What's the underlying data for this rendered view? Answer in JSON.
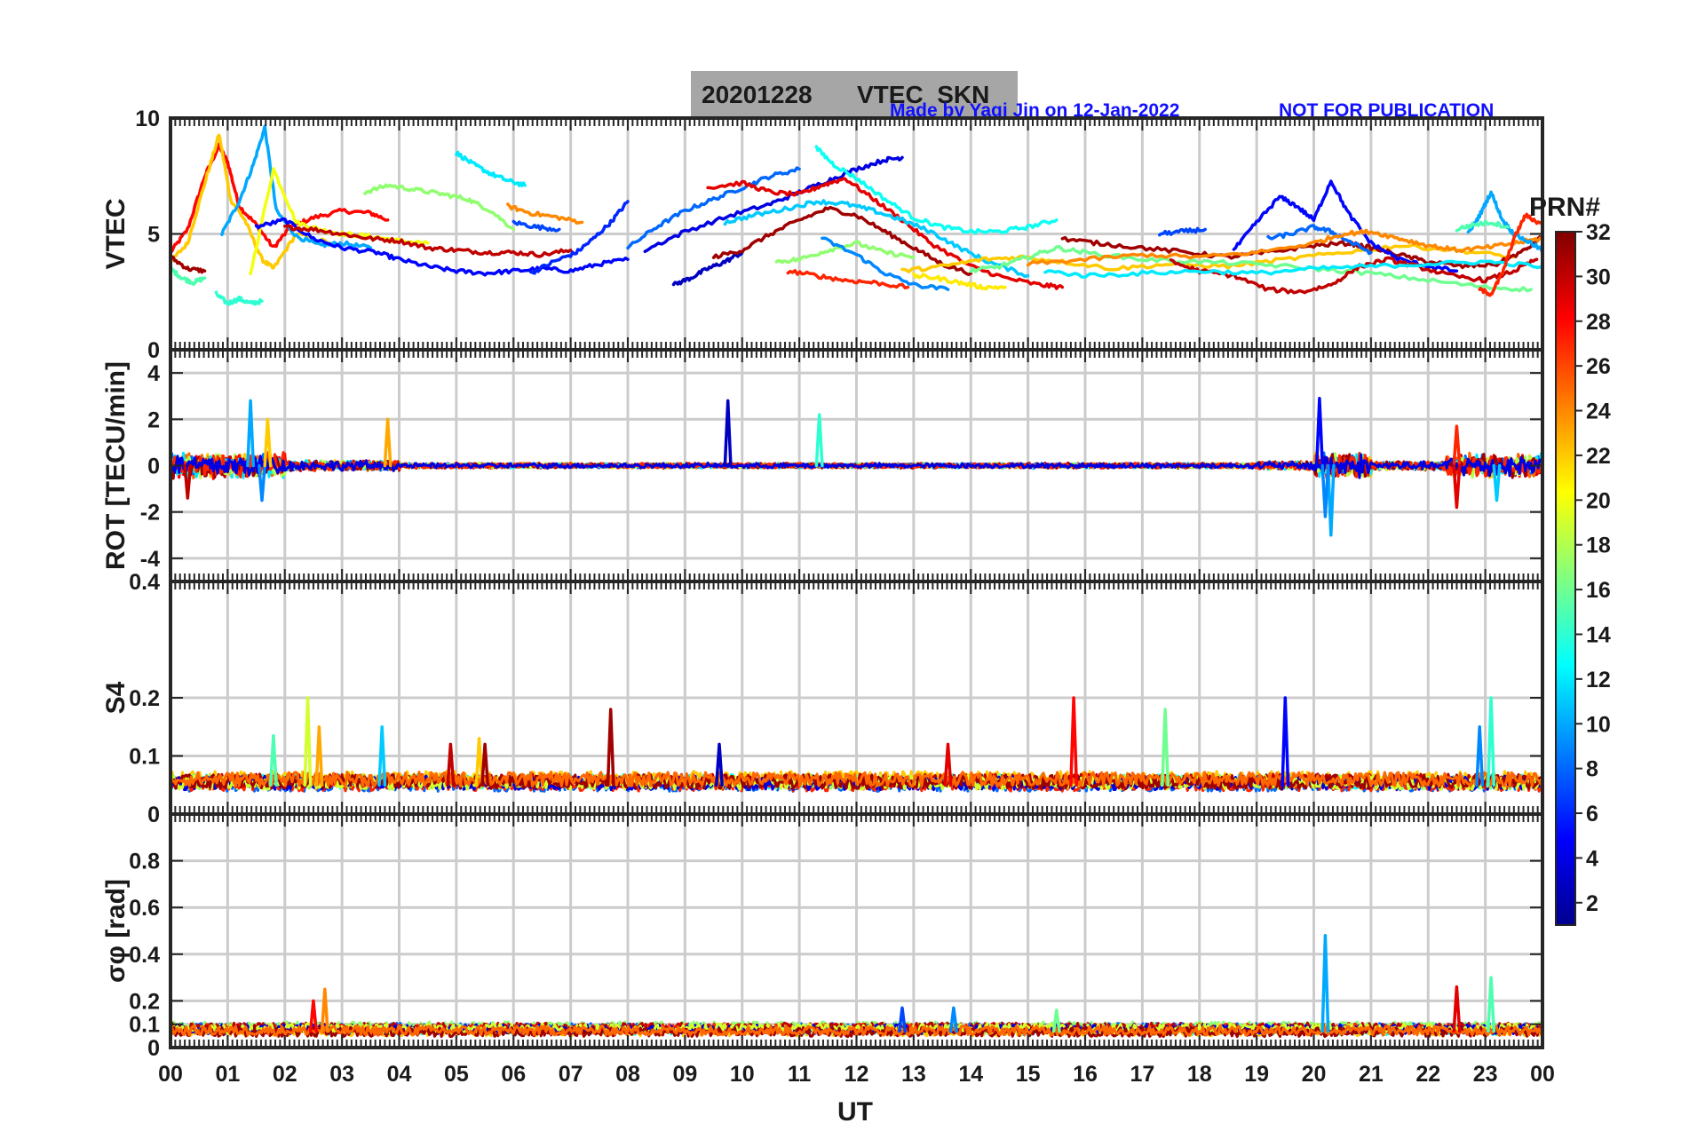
{
  "figure": {
    "title_date": "20201228",
    "title_name": "VTEC  SKN",
    "credit": "Made by Yaqi Jin on 12-Jan-2022",
    "notice": "NOT FOR PUBLICATION",
    "xlabel": "UT",
    "colorbar_label": "PRN#",
    "colorbar_ticks": [
      "2",
      "4",
      "6",
      "8",
      "10",
      "12",
      "14",
      "16",
      "18",
      "20",
      "22",
      "24",
      "26",
      "28",
      "30",
      "32"
    ],
    "title_box_color": "#a6a6a6",
    "credit_color": "#1010ff"
  },
  "chart_data": [
    {
      "type": "line",
      "ylabel": "VTEC",
      "ylim": [
        0,
        10
      ],
      "yticks": [
        "0",
        "5",
        "10"
      ],
      "xlim": [
        0,
        24
      ],
      "grid": true,
      "series": [
        {
          "prn": 28,
          "x": [
            0.0,
            0.3,
            0.6,
            0.85,
            1.0,
            1.2,
            1.5,
            1.8,
            2.1,
            2.5,
            3.0,
            3.5,
            3.8
          ],
          "y": [
            4.2,
            5.2,
            7.5,
            8.8,
            8.1,
            6.2,
            5.4,
            4.4,
            5.3,
            5.7,
            6.0,
            5.9,
            5.6
          ]
        },
        {
          "prn": 22,
          "x": [
            0.0,
            0.3,
            0.6,
            0.85,
            1.05,
            1.3,
            1.6,
            1.8,
            2.2,
            2.8
          ],
          "y": [
            3.8,
            4.6,
            7.2,
            9.3,
            6.5,
            5.6,
            3.9,
            3.5,
            5.0,
            4.6
          ]
        },
        {
          "prn": 10,
          "x": [
            0.9,
            1.2,
            1.45,
            1.65,
            1.85,
            2.2,
            2.6,
            3.0,
            3.5
          ],
          "y": [
            5.0,
            6.4,
            8.0,
            9.6,
            6.0,
            4.9,
            4.5,
            4.6,
            4.4
          ]
        },
        {
          "prn": 20,
          "x": [
            1.4,
            1.8,
            2.2,
            2.6,
            3.0,
            3.5,
            4.0,
            4.5
          ],
          "y": [
            3.3,
            7.8,
            5.5,
            5.2,
            5.0,
            4.9,
            4.7,
            4.6
          ]
        },
        {
          "prn": 14,
          "x": [
            0.8,
            1.0,
            1.2,
            1.4,
            1.6
          ],
          "y": [
            2.4,
            2.0,
            2.2,
            2.0,
            2.1
          ]
        },
        {
          "prn": 15,
          "x": [
            0.0,
            0.2,
            0.4,
            0.6
          ],
          "y": [
            3.5,
            3.1,
            2.9,
            3.1
          ]
        },
        {
          "prn": 31,
          "x": [
            0.0,
            0.3,
            0.6
          ],
          "y": [
            4.0,
            3.5,
            3.4
          ]
        },
        {
          "prn": 5,
          "x": [
            1.5,
            2.0,
            2.5,
            3.0,
            3.6,
            4.0,
            4.5,
            5.0,
            5.5,
            6.0,
            6.5,
            7.0,
            7.5,
            8.0
          ],
          "y": [
            5.3,
            5.6,
            4.8,
            4.4,
            4.2,
            3.9,
            3.6,
            3.4,
            3.3,
            3.4,
            3.5,
            3.4,
            3.7,
            3.9
          ]
        },
        {
          "prn": 30,
          "x": [
            2.0,
            2.5,
            3.0,
            3.5,
            4.0,
            4.5,
            5.0,
            5.5,
            6.0,
            6.5,
            7.0
          ],
          "y": [
            5.3,
            5.2,
            5.0,
            4.8,
            4.7,
            4.4,
            4.3,
            4.2,
            4.2,
            4.1,
            4.3
          ]
        },
        {
          "prn": 17,
          "x": [
            3.4,
            3.8,
            4.3,
            4.8,
            5.2,
            5.6,
            6.0
          ],
          "y": [
            6.8,
            7.1,
            6.9,
            6.7,
            6.5,
            6.0,
            5.2
          ]
        },
        {
          "prn": 12,
          "x": [
            5.0,
            5.3,
            5.6,
            5.9,
            6.2
          ],
          "y": [
            8.5,
            8.0,
            7.6,
            7.3,
            7.1
          ]
        },
        {
          "prn": 24,
          "x": [
            5.9,
            6.3,
            6.8,
            7.2
          ],
          "y": [
            6.2,
            5.9,
            5.7,
            5.5
          ]
        },
        {
          "prn": 6,
          "x": [
            6.3,
            6.7,
            7.1,
            7.4,
            7.7,
            8.0
          ],
          "y": [
            3.3,
            3.8,
            4.2,
            4.8,
            5.5,
            6.4
          ]
        },
        {
          "prn": 7,
          "x": [
            6.0,
            6.4,
            6.8
          ],
          "y": [
            5.5,
            5.3,
            5.2
          ]
        },
        {
          "prn": 3,
          "x": [
            8.8,
            9.1,
            9.4,
            9.7,
            10.0
          ],
          "y": [
            2.8,
            3.1,
            3.5,
            3.8,
            4.2
          ]
        },
        {
          "prn": 8,
          "x": [
            8.0,
            8.5,
            9.0,
            9.5,
            10.0,
            10.5,
            11.0
          ],
          "y": [
            4.4,
            5.3,
            6.0,
            6.5,
            7.0,
            7.5,
            7.8
          ]
        },
        {
          "prn": 4,
          "x": [
            8.3,
            9.0,
            9.8,
            10.5,
            11.0,
            11.5,
            12.0,
            12.5,
            12.8
          ],
          "y": [
            4.3,
            5.1,
            5.8,
            6.3,
            6.8,
            7.3,
            7.8,
            8.2,
            8.3
          ]
        },
        {
          "prn": 29,
          "x": [
            9.4,
            10.0,
            10.5,
            11.0,
            11.4,
            11.8,
            12.3,
            12.8,
            13.3,
            14.0,
            14.6,
            15.2,
            15.6
          ],
          "y": [
            7.0,
            7.2,
            6.8,
            6.7,
            7.1,
            7.4,
            6.5,
            5.6,
            4.6,
            3.6,
            3.1,
            2.8,
            2.7
          ]
        },
        {
          "prn": 31,
          "x": [
            9.5,
            10.0,
            10.5,
            11.0,
            11.5,
            12.0,
            12.5,
            13.0,
            13.5,
            14.0
          ],
          "y": [
            4.0,
            4.3,
            5.0,
            5.6,
            6.1,
            5.8,
            5.1,
            4.4,
            3.7,
            3.3
          ]
        },
        {
          "prn": 13,
          "x": [
            11.3,
            11.6,
            12.0,
            12.5,
            13.0,
            13.5,
            14.0,
            14.5,
            15.0,
            15.5
          ],
          "y": [
            8.7,
            8.0,
            7.4,
            6.5,
            5.7,
            5.3,
            5.1,
            5.1,
            5.3,
            5.6
          ]
        },
        {
          "prn": 11,
          "x": [
            9.7,
            10.2,
            10.8,
            11.3,
            11.8,
            12.3,
            12.8,
            13.3,
            13.8,
            14.3,
            15.0
          ],
          "y": [
            5.5,
            5.8,
            6.1,
            6.4,
            6.3,
            6.0,
            5.6,
            5.1,
            4.4,
            3.8,
            3.2
          ]
        },
        {
          "prn": 17,
          "x": [
            10.6,
            11.0,
            11.5,
            12.0,
            12.5,
            13.0
          ],
          "y": [
            3.8,
            3.9,
            4.3,
            4.6,
            4.2,
            4.0
          ]
        },
        {
          "prn": 9,
          "x": [
            11.4,
            12.0,
            12.5,
            13.0,
            13.6
          ],
          "y": [
            4.8,
            4.1,
            3.3,
            2.8,
            2.6
          ]
        },
        {
          "prn": 27,
          "x": [
            10.8,
            11.3,
            11.8,
            12.3,
            12.9
          ],
          "y": [
            3.4,
            3.2,
            3.0,
            2.9,
            2.7
          ]
        },
        {
          "prn": 21,
          "x": [
            13.0,
            13.4,
            13.8,
            14.2,
            14.6
          ],
          "y": [
            3.2,
            3.1,
            2.9,
            2.7,
            2.7
          ]
        },
        {
          "prn": 22,
          "x": [
            12.8,
            13.5,
            14.2,
            14.9,
            15.6,
            16.5,
            17.5,
            18.5,
            19.5,
            20.5,
            21.5,
            22.5,
            23.5
          ],
          "y": [
            3.4,
            3.6,
            3.9,
            4.0,
            3.8,
            3.5,
            3.7,
            3.6,
            3.9,
            4.2,
            4.5,
            4.3,
            4.0
          ]
        },
        {
          "prn": 16,
          "x": [
            14.0,
            14.5,
            15.0,
            15.5,
            16.0,
            17.0,
            18.0,
            19.0,
            20.0,
            21.0,
            22.0,
            23.0,
            23.8
          ],
          "y": [
            3.4,
            3.6,
            4.0,
            4.4,
            4.2,
            3.9,
            3.8,
            3.7,
            3.5,
            3.3,
            3.0,
            2.7,
            2.6
          ]
        },
        {
          "prn": 31,
          "x": [
            15.6,
            16.2,
            17.0,
            17.8,
            18.5,
            19.2,
            20.0,
            20.6,
            21.0,
            21.5,
            22.0,
            22.6,
            23.2,
            23.7,
            24.0
          ],
          "y": [
            4.8,
            4.6,
            4.4,
            4.2,
            4.0,
            4.2,
            4.5,
            4.6,
            4.4,
            4.1,
            3.8,
            3.6,
            3.7,
            4.3,
            4.9
          ]
        },
        {
          "prn": 7,
          "x": [
            17.3,
            17.7,
            18.1
          ],
          "y": [
            5.0,
            5.1,
            5.2
          ]
        },
        {
          "prn": 5,
          "x": [
            18.6,
            19.0,
            19.4,
            19.7,
            20.0,
            20.3,
            20.6,
            21.0,
            21.5,
            22.0,
            22.5
          ],
          "y": [
            4.3,
            5.5,
            6.6,
            6.2,
            5.6,
            7.3,
            5.9,
            4.6,
            3.9,
            3.6,
            3.4
          ]
        },
        {
          "prn": 8,
          "x": [
            19.2,
            19.6,
            20.0,
            20.3,
            20.6,
            21.0
          ],
          "y": [
            4.8,
            5.0,
            5.3,
            5.1,
            4.7,
            4.2
          ]
        },
        {
          "prn": 30,
          "x": [
            17.5,
            18.0,
            18.6,
            19.2,
            19.8,
            20.3,
            20.8,
            21.3,
            21.8,
            22.4,
            23.0,
            23.5,
            23.9
          ],
          "y": [
            3.8,
            3.4,
            3.2,
            2.6,
            2.5,
            2.8,
            3.6,
            3.9,
            3.6,
            3.2,
            3.0,
            3.4,
            3.9
          ]
        },
        {
          "prn": 24,
          "x": [
            15.0,
            16.0,
            17.0,
            18.0,
            19.0,
            20.0,
            20.5,
            21.0,
            21.5,
            22.0,
            22.5,
            23.0,
            23.5,
            24.0
          ],
          "y": [
            3.7,
            3.9,
            4.1,
            4.0,
            4.2,
            4.6,
            5.0,
            5.1,
            4.8,
            4.5,
            4.3,
            4.4,
            4.6,
            4.8
          ]
        },
        {
          "prn": 12,
          "x": [
            15.3,
            16.0,
            17.0,
            18.0,
            19.0,
            20.0,
            21.0,
            22.0,
            23.0,
            24.0
          ],
          "y": [
            3.4,
            3.2,
            3.3,
            3.4,
            3.3,
            3.5,
            3.6,
            3.7,
            3.8,
            3.6
          ]
        },
        {
          "prn": 10,
          "x": [
            22.7,
            22.9,
            23.1,
            23.3,
            23.5,
            23.8,
            24.0
          ],
          "y": [
            5.0,
            5.8,
            6.8,
            5.6,
            5.0,
            4.6,
            4.3
          ]
        },
        {
          "prn": 27,
          "x": [
            22.9,
            23.1,
            23.3,
            23.5,
            23.7,
            24.0
          ],
          "y": [
            2.6,
            2.4,
            3.3,
            4.8,
            5.8,
            5.4
          ]
        },
        {
          "prn": 15,
          "x": [
            22.5,
            22.8,
            23.1,
            23.4
          ],
          "y": [
            5.2,
            5.4,
            5.5,
            5.3
          ]
        }
      ]
    },
    {
      "type": "line",
      "ylabel": "ROT [TECU/min]",
      "ylim": [
        -5,
        5
      ],
      "yticks": [
        "-4",
        "-2",
        "0",
        "2",
        "4"
      ],
      "xlim": [
        0,
        24
      ],
      "grid": true,
      "noise_bands": [
        {
          "x0": 0.0,
          "x1": 2.0,
          "amp": 0.6
        },
        {
          "x0": 2.0,
          "x1": 4.0,
          "amp": 0.25
        },
        {
          "x0": 4.0,
          "x1": 19.0,
          "amp": 0.12
        },
        {
          "x0": 19.0,
          "x1": 20.0,
          "amp": 0.2
        },
        {
          "x0": 20.0,
          "x1": 21.0,
          "amp": 0.6
        },
        {
          "x0": 21.0,
          "x1": 22.3,
          "amp": 0.2
        },
        {
          "x0": 22.3,
          "x1": 24.0,
          "amp": 0.55
        }
      ],
      "spikes": [
        {
          "x": 1.4,
          "y": 2.8,
          "prn": 10
        },
        {
          "x": 1.6,
          "y": -1.5,
          "prn": 9
        },
        {
          "x": 1.7,
          "y": 2.0,
          "prn": 22
        },
        {
          "x": 3.8,
          "y": 2.0,
          "prn": 23
        },
        {
          "x": 0.3,
          "y": -1.4,
          "prn": 30
        },
        {
          "x": 9.75,
          "y": 2.8,
          "prn": 3
        },
        {
          "x": 11.35,
          "y": 2.2,
          "prn": 14
        },
        {
          "x": 20.1,
          "y": 2.9,
          "prn": 5
        },
        {
          "x": 20.3,
          "y": -3.0,
          "prn": 10
        },
        {
          "x": 20.2,
          "y": -2.2,
          "prn": 9
        },
        {
          "x": 22.5,
          "y": 1.7,
          "prn": 27
        },
        {
          "x": 22.5,
          "y": -1.8,
          "prn": 29
        },
        {
          "x": 23.2,
          "y": -1.5,
          "prn": 11
        }
      ]
    },
    {
      "type": "line",
      "ylabel": "S4",
      "ylim": [
        0,
        0.4
      ],
      "yticks": [
        "0",
        "0.1",
        "0.2",
        "0.4"
      ],
      "xlim": [
        0,
        24
      ],
      "grid": true,
      "baseline": 0.05,
      "noise_amp": 0.015,
      "spikes": [
        {
          "x": 2.4,
          "y": 0.2,
          "prn": 19
        },
        {
          "x": 2.6,
          "y": 0.15,
          "prn": 23
        },
        {
          "x": 1.8,
          "y": 0.135,
          "prn": 15
        },
        {
          "x": 3.7,
          "y": 0.15,
          "prn": 11
        },
        {
          "x": 4.9,
          "y": 0.12,
          "prn": 30
        },
        {
          "x": 5.4,
          "y": 0.13,
          "prn": 22
        },
        {
          "x": 5.5,
          "y": 0.12,
          "prn": 31
        },
        {
          "x": 7.7,
          "y": 0.18,
          "prn": 31
        },
        {
          "x": 9.6,
          "y": 0.12,
          "prn": 3
        },
        {
          "x": 13.6,
          "y": 0.12,
          "prn": 29
        },
        {
          "x": 15.8,
          "y": 0.2,
          "prn": 28
        },
        {
          "x": 17.4,
          "y": 0.18,
          "prn": 16
        },
        {
          "x": 19.5,
          "y": 0.2,
          "prn": 5
        },
        {
          "x": 22.9,
          "y": 0.15,
          "prn": 9
        },
        {
          "x": 23.1,
          "y": 0.2,
          "prn": 14
        }
      ]
    },
    {
      "type": "line",
      "ylabel": "σφ [rad]",
      "ylim": [
        0,
        1
      ],
      "yticks": [
        "0",
        "0.1",
        "0.2",
        "0.4",
        "0.6",
        "0.8"
      ],
      "xlim": [
        0,
        24
      ],
      "grid": true,
      "baseline": 0.07,
      "noise_amp": 0.025,
      "spikes": [
        {
          "x": 2.7,
          "y": 0.25,
          "prn": 24
        },
        {
          "x": 2.5,
          "y": 0.2,
          "prn": 28
        },
        {
          "x": 20.2,
          "y": 0.48,
          "prn": 10
        },
        {
          "x": 22.5,
          "y": 0.26,
          "prn": 29
        },
        {
          "x": 23.1,
          "y": 0.3,
          "prn": 15
        },
        {
          "x": 12.8,
          "y": 0.17,
          "prn": 7
        },
        {
          "x": 13.7,
          "y": 0.17,
          "prn": 9
        },
        {
          "x": 15.5,
          "y": 0.16,
          "prn": 16
        }
      ]
    }
  ],
  "x_ticks": [
    "00",
    "01",
    "02",
    "03",
    "04",
    "05",
    "06",
    "07",
    "08",
    "09",
    "10",
    "11",
    "12",
    "13",
    "14",
    "15",
    "16",
    "17",
    "18",
    "19",
    "20",
    "21",
    "22",
    "23",
    "00"
  ]
}
